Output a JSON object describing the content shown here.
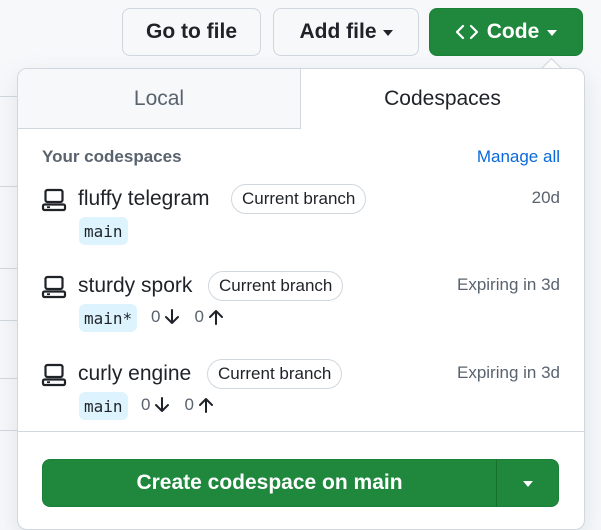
{
  "toolbar": {
    "go_to_file": "Go to file",
    "add_file": "Add file",
    "code": "Code"
  },
  "tabs": [
    {
      "label": "Local",
      "selected": false
    },
    {
      "label": "Codespaces",
      "selected": true
    }
  ],
  "section": {
    "title": "Your codespaces",
    "manage_all": "Manage all"
  },
  "codespaces": [
    {
      "name": "fluffy telegram",
      "badge": "Current branch",
      "status": "20d",
      "branch": "main",
      "behind": "",
      "ahead": ""
    },
    {
      "name": "sturdy spork",
      "badge": "Current branch",
      "status": "Expiring in 3d",
      "branch": "main*",
      "behind": "0",
      "ahead": "0"
    },
    {
      "name": "curly engine",
      "badge": "Current branch",
      "status": "Expiring in 3d",
      "branch": "main",
      "behind": "0",
      "ahead": "0"
    }
  ],
  "create": {
    "label": "Create codespace on main"
  },
  "colors": {
    "primary_green": "#1f883d",
    "link_blue": "#0969da",
    "branch_bg": "#ddf4ff"
  },
  "icons": {
    "code": "code-brackets-icon",
    "codespace": "codespace-laptop-icon",
    "behind": "arrow-down-icon",
    "ahead": "arrow-up-icon"
  }
}
